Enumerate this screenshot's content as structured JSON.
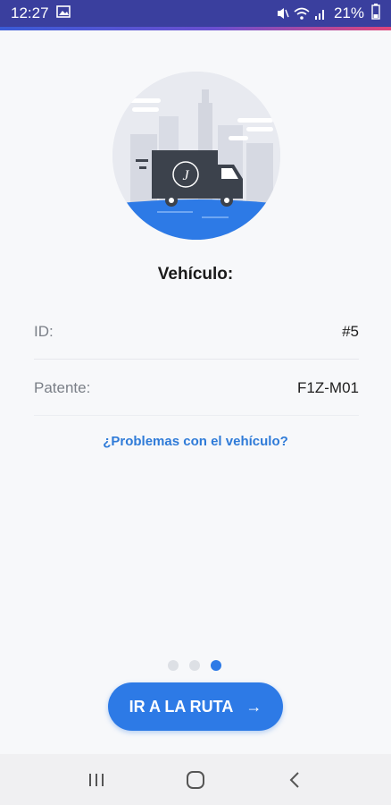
{
  "status_bar": {
    "time": "12:27",
    "battery": "21%",
    "icons": [
      "image-icon",
      "mute-icon",
      "wifi-icon",
      "signal-icon",
      "battery-icon"
    ]
  },
  "vehicle": {
    "title": "Vehículo:",
    "id_label": "ID:",
    "id_value": "#5",
    "plate_label": "Patente:",
    "plate_value": "F1Z-M01",
    "problem_link": "¿Problemas con el vehículo?"
  },
  "pager": {
    "total": 3,
    "active_index": 2
  },
  "cta": {
    "label": "IR A LA RUTA",
    "arrow": "→"
  },
  "nav": {
    "icons": [
      "recent-apps-icon",
      "home-icon",
      "back-icon"
    ]
  },
  "colors": {
    "accent": "#2d7ae6",
    "status_bar": "#3a3f9e",
    "link": "#2f7bd8"
  }
}
